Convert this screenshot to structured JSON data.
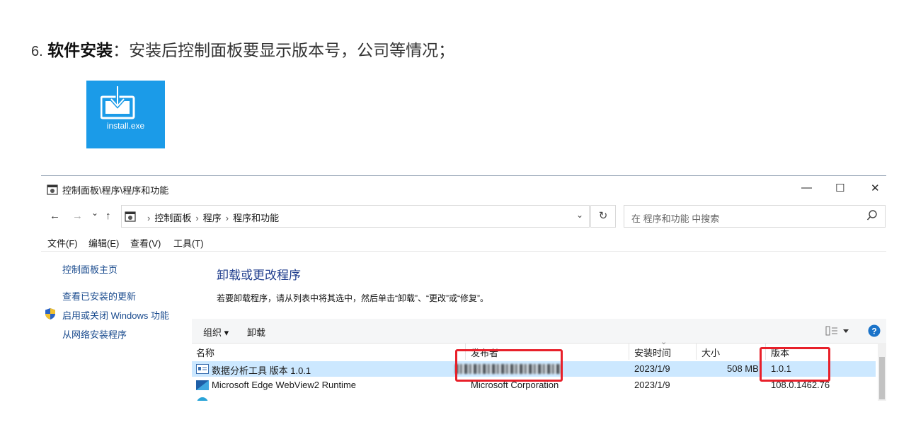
{
  "doc": {
    "step_number": "6.",
    "step_bold": "软件安装",
    "step_text": "：安装后控制面板要显示版本号，公司等情况；",
    "file_label": "install.exe"
  },
  "window": {
    "title": "控制面板\\程序\\程序和功能",
    "controls": {
      "minimize": "—",
      "maximize": "☐",
      "close": "✕"
    },
    "nav": {
      "back": "←",
      "forward": "→",
      "recent": "⌄",
      "up": "↑"
    },
    "address": {
      "crumbs": [
        "控制面板",
        "程序",
        "程序和功能"
      ],
      "separator": "›",
      "dropdown": "⌄"
    },
    "refresh": "↻",
    "search": {
      "placeholder": "在 程序和功能 中搜索",
      "icon": "search-icon"
    },
    "menu": [
      "文件(F)",
      "编辑(E)",
      "查看(V)",
      "工具(T)"
    ],
    "left_links": [
      "控制面板主页",
      "查看已安装的更新",
      "启用或关闭 Windows 功能",
      "从网络安装程序"
    ],
    "main": {
      "title": "卸载或更改程序",
      "subtitle": "若要卸载程序，请从列表中将其选中，然后单击“卸载”、“更改”或“修复”。"
    },
    "toolbar": {
      "organize": "组织 ▾",
      "uninstall": "卸载",
      "view_icon": "view-options-icon",
      "help": "?"
    },
    "columns": [
      "名称",
      "发布者",
      "安装时间",
      "大小",
      "版本"
    ],
    "rows": [
      {
        "name": "数据分析工具 版本 1.0.1",
        "publisher": "",
        "date": "2023/1/9",
        "size": "508 MB",
        "version": "1.0.1",
        "selected": true
      },
      {
        "name": "Microsoft Edge WebView2 Runtime",
        "publisher": "Microsoft Corporation",
        "date": "2023/1/9",
        "size": "",
        "version": "108.0.1462.76",
        "selected": false
      }
    ]
  },
  "colors": {
    "accent": "#1b9be8",
    "selection": "#cce8ff",
    "highlight_box": "#e8202a",
    "link": "#1a4b8e",
    "heading": "#1e3c8c"
  }
}
